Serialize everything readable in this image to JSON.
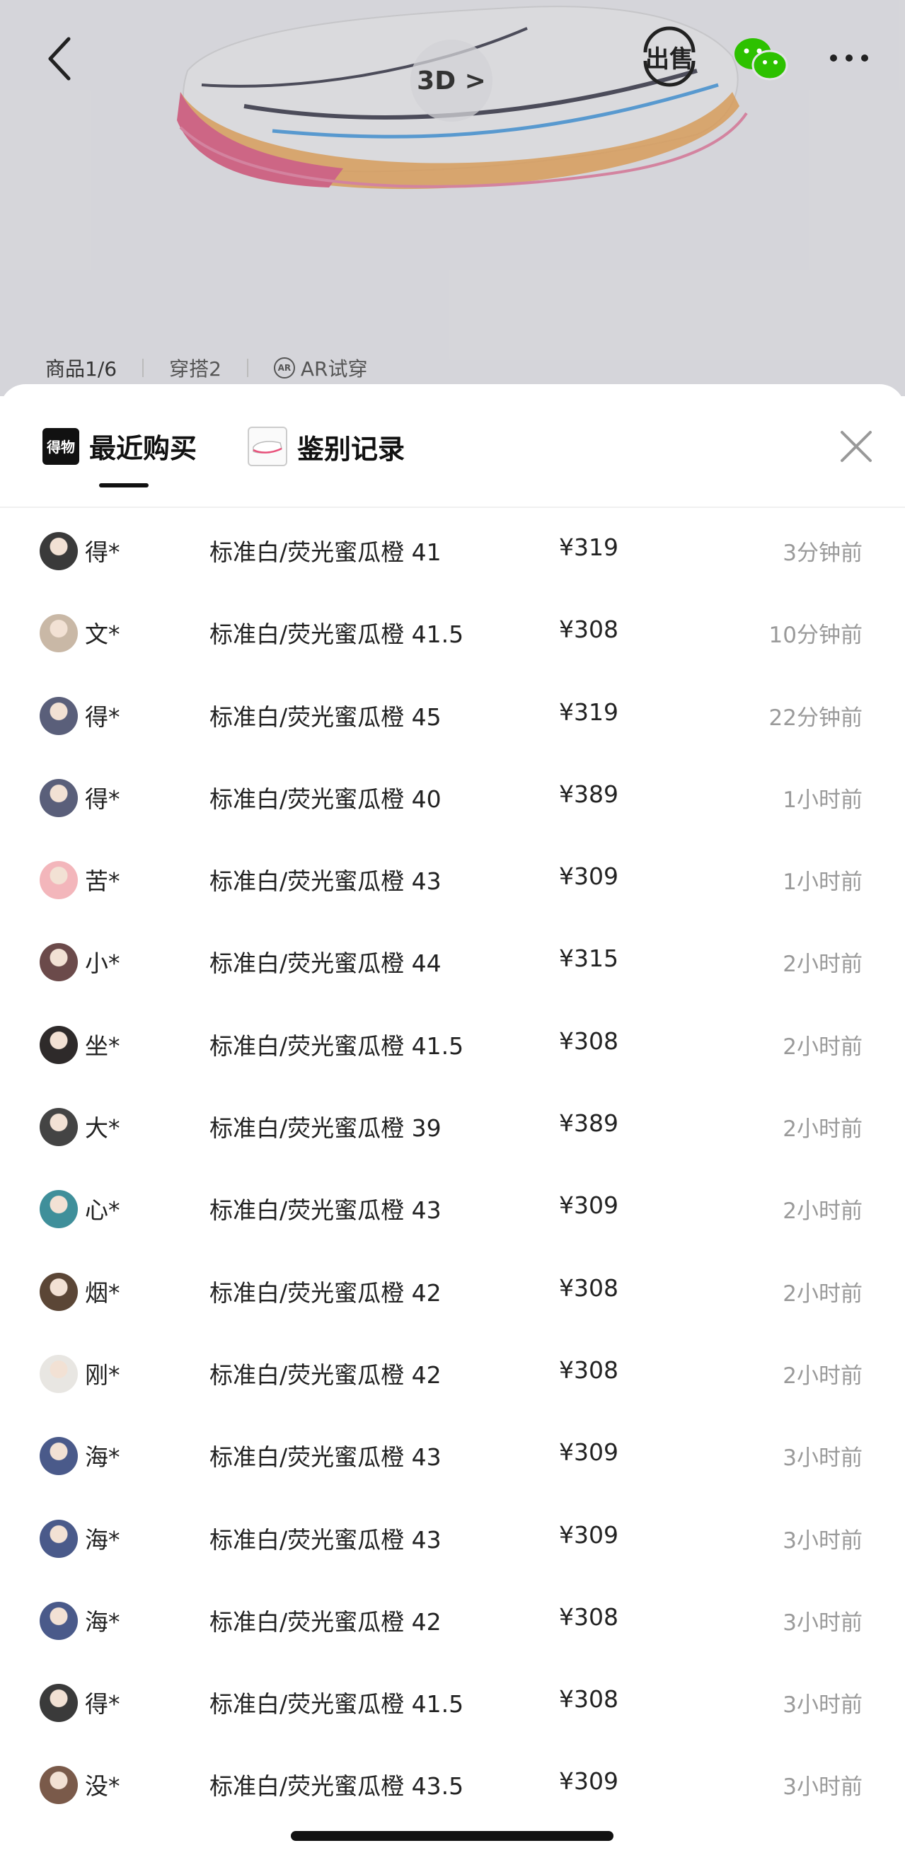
{
  "header": {
    "btn_3d": "3D >",
    "sell_label": "出售",
    "tabs": [
      {
        "label": "商品1/6"
      },
      {
        "label": "穿搭2"
      },
      {
        "label": "AR试穿",
        "icon_text": "AR"
      }
    ]
  },
  "sheet": {
    "tab_recent": {
      "label": "最近购买",
      "logo_text": "得物"
    },
    "tab_auth": {
      "label": "鉴别记录"
    }
  },
  "colors": {
    "accent_text": "#111111",
    "muted_text": "#9a9a9a",
    "shoe_pink": "#e8507a",
    "shoe_orange": "#f6a03c",
    "shoe_blue": "#3c9be6",
    "wechat_green": "#2dc100"
  },
  "records": [
    {
      "user": "得*",
      "spec": "标准白/荧光蜜瓜橙 41",
      "price": "¥319",
      "time": "3分钟前",
      "avatar": "#3a3a3a"
    },
    {
      "user": "文*",
      "spec": "标准白/荧光蜜瓜橙 41.5",
      "price": "¥308",
      "time": "10分钟前",
      "avatar": "#c9b8a6"
    },
    {
      "user": "得*",
      "spec": "标准白/荧光蜜瓜橙 45",
      "price": "¥319",
      "time": "22分钟前",
      "avatar": "#5a5f7a"
    },
    {
      "user": "得*",
      "spec": "标准白/荧光蜜瓜橙 40",
      "price": "¥389",
      "time": "1小时前",
      "avatar": "#5a5f7a"
    },
    {
      "user": "苦*",
      "spec": "标准白/荧光蜜瓜橙 43",
      "price": "¥309",
      "time": "1小时前",
      "avatar": "#f3b6bb"
    },
    {
      "user": "小*",
      "spec": "标准白/荧光蜜瓜橙 44",
      "price": "¥315",
      "time": "2小时前",
      "avatar": "#6b4a4a"
    },
    {
      "user": "坐*",
      "spec": "标准白/荧光蜜瓜橙 41.5",
      "price": "¥308",
      "time": "2小时前",
      "avatar": "#2e2a2a"
    },
    {
      "user": "大*",
      "spec": "标准白/荧光蜜瓜橙 39",
      "price": "¥389",
      "time": "2小时前",
      "avatar": "#444444"
    },
    {
      "user": "心*",
      "spec": "标准白/荧光蜜瓜橙 43",
      "price": "¥309",
      "time": "2小时前",
      "avatar": "#3f8f9a"
    },
    {
      "user": "烟*",
      "spec": "标准白/荧光蜜瓜橙 42",
      "price": "¥308",
      "time": "2小时前",
      "avatar": "#5b4636"
    },
    {
      "user": "刚*",
      "spec": "标准白/荧光蜜瓜橙 42",
      "price": "¥308",
      "time": "2小时前",
      "avatar": "#e8e6e2"
    },
    {
      "user": "海*",
      "spec": "标准白/荧光蜜瓜橙 43",
      "price": "¥309",
      "time": "3小时前",
      "avatar": "#4a5a8a"
    },
    {
      "user": "海*",
      "spec": "标准白/荧光蜜瓜橙 43",
      "price": "¥309",
      "time": "3小时前",
      "avatar": "#4a5a8a"
    },
    {
      "user": "海*",
      "spec": "标准白/荧光蜜瓜橙 42",
      "price": "¥308",
      "time": "3小时前",
      "avatar": "#4a5a8a"
    },
    {
      "user": "得*",
      "spec": "标准白/荧光蜜瓜橙 41.5",
      "price": "¥308",
      "time": "3小时前",
      "avatar": "#3a3a3a"
    },
    {
      "user": "没*",
      "spec": "标准白/荧光蜜瓜橙 43.5",
      "price": "¥309",
      "time": "3小时前",
      "avatar": "#7a5a4a"
    }
  ]
}
